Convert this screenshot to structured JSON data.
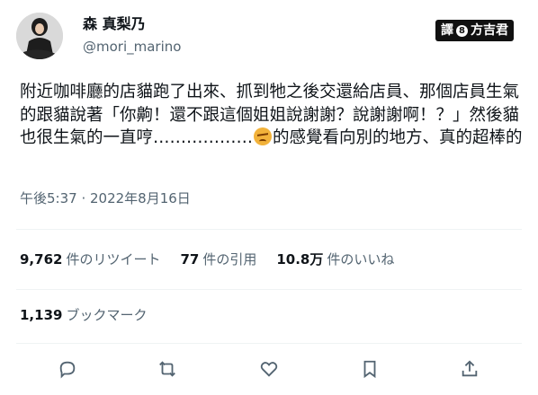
{
  "author": {
    "display_name": "森 真梨乃",
    "handle": "@mori_marino"
  },
  "watermark": {
    "text": "譯",
    "text2": "方吉君"
  },
  "tweet": {
    "text_part1": "附近咖啡廳的店貓跑了出來、抓到牠之後交還給店員、那個店員生氣的跟貓說著「你齁！還不跟這個姐姐說謝謝？說謝謝啊！？」然後貓也很生氣的一直哼………………",
    "emoji_icon": "angry-face-icon",
    "text_part2": "的感覺看向別的地方、真的超棒的"
  },
  "timestamp": "午後5:37 · 2022年8月16日",
  "stats": {
    "retweets_count": "9,762",
    "retweets_label": "件のリツイート",
    "quotes_count": "77",
    "quotes_label": "件の引用",
    "likes_count": "10.8万",
    "likes_label": "件のいいね"
  },
  "bookmarks": {
    "count": "1,139",
    "label": "ブックマーク"
  },
  "actions": [
    "reply-icon",
    "retweet-icon",
    "like-icon",
    "bookmark-icon",
    "share-icon"
  ],
  "colors": {
    "secondary_text": "#536471",
    "primary_text": "#0f1419",
    "divider": "#eff3f4"
  }
}
